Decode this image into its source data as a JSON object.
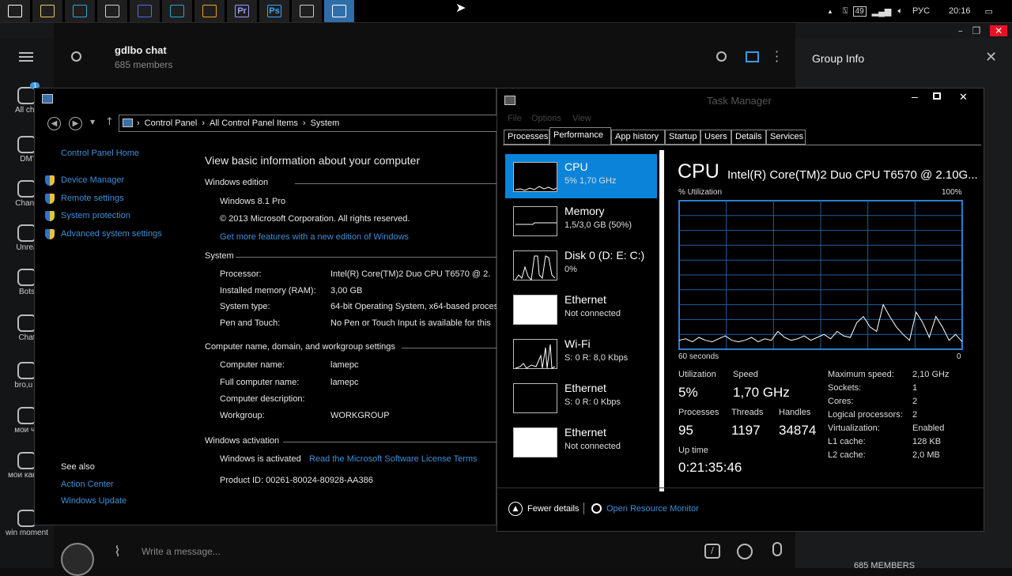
{
  "taskbar": {
    "apps": [
      {
        "icon": "windows-start-icon",
        "color": "#ffffff"
      },
      {
        "icon": "file-explorer-icon",
        "color": "#e8c860"
      },
      {
        "icon": "edge-icon",
        "color": "#36a2e0"
      },
      {
        "icon": "steam-icon",
        "color": "#c7d5e0"
      },
      {
        "icon": "discord-icon",
        "color": "#5865f2"
      },
      {
        "icon": "telegram-icon",
        "color": "#2aa3e0"
      },
      {
        "icon": "app-icon",
        "color": "#f0a020"
      },
      {
        "icon": "premiere-icon",
        "color": "#9999ff",
        "text": "Pr"
      },
      {
        "icon": "photoshop-icon",
        "color": "#31a8ff",
        "text": "Ps"
      },
      {
        "icon": "system-window-icon",
        "color": "#cccccc"
      },
      {
        "icon": "task-manager-icon",
        "color": "#ffffff"
      }
    ],
    "tray": {
      "battery": "49",
      "lang": "РУС",
      "time": "20:16"
    }
  },
  "telegram": {
    "header": {
      "title": "gdlbo chat",
      "subtitle": "685 members"
    },
    "right_panel": {
      "title": "Group Info",
      "members_label": "685 MEMBERS"
    },
    "input_placeholder": "Write a message...",
    "folders": [
      {
        "label": "All cha",
        "badge": "1"
      },
      {
        "label": "DM'"
      },
      {
        "label": "Chann"
      },
      {
        "label": "Unrea"
      },
      {
        "label": "Bots"
      },
      {
        "label": "Chat"
      },
      {
        "label": "bro,u p"
      },
      {
        "label": "мои ча"
      },
      {
        "label": "мои канал"
      },
      {
        "label": "win moment"
      }
    ]
  },
  "control_panel": {
    "breadcrumb": [
      "Control Panel",
      "All Control Panel Items",
      "System"
    ],
    "left_nav": {
      "home": "Control Panel Home",
      "links": [
        "Device Manager",
        "Remote settings",
        "System protection",
        "Advanced system settings"
      ],
      "see_also": "See also",
      "see_also_links": [
        "Action Center",
        "Windows Update"
      ]
    },
    "heading": "View basic information about your computer",
    "edition": {
      "section": "Windows edition",
      "name": "Windows 8.1 Pro",
      "copyright": "© 2013 Microsoft Corporation. All rights reserved.",
      "more_link": "Get more features with a new edition of Windows"
    },
    "system": {
      "section": "System",
      "rows": [
        {
          "label": "Processor:",
          "value": "Intel(R) Core(TM)2 Duo CPU     T6570  @ 2."
        },
        {
          "label": "Installed memory (RAM):",
          "value": "3,00 GB"
        },
        {
          "label": "System type:",
          "value": "64-bit Operating System, x64-based proces"
        },
        {
          "label": "Pen and Touch:",
          "value": "No Pen or Touch Input is available for this"
        }
      ]
    },
    "computer": {
      "section": "Computer name, domain, and workgroup settings",
      "rows": [
        {
          "label": "Computer name:",
          "value": "lamepc"
        },
        {
          "label": "Full computer name:",
          "value": "lamepc"
        },
        {
          "label": "Computer description:",
          "value": ""
        },
        {
          "label": "Workgroup:",
          "value": "WORKGROUP"
        }
      ]
    },
    "activation": {
      "section": "Windows activation",
      "status": "Windows is activated",
      "license_link": "Read the Microsoft Software License Terms",
      "product_id": "Product ID:  00261-80024-80928-AA386"
    }
  },
  "task_manager": {
    "title": "Task Manager",
    "menu": [
      "File",
      "Options",
      "View"
    ],
    "tabs": [
      "Processes",
      "Performance",
      "App history",
      "Startup",
      "Users",
      "Details",
      "Services"
    ],
    "selected_tab": "Performance",
    "sidebar": [
      {
        "name": "CPU",
        "sub": "5%  1,70 GHz",
        "selected": true
      },
      {
        "name": "Memory",
        "sub": "1,5/3,0 GB (50%)"
      },
      {
        "name": "Disk 0 (D: E: C:)",
        "sub": "0%"
      },
      {
        "name": "Ethernet",
        "sub": "Not connected"
      },
      {
        "name": "Wi-Fi",
        "sub": "S: 0 R: 8,0 Kbps"
      },
      {
        "name": "Ethernet",
        "sub": "S: 0 R: 0 Kbps"
      },
      {
        "name": "Ethernet",
        "sub": "Not connected"
      }
    ],
    "cpu": {
      "title": "CPU",
      "model": "Intel(R) Core(TM)2 Duo CPU T6570 @ 2.10G...",
      "util_label": "% Utilization",
      "max_label": "100%",
      "time_label": "60 seconds",
      "zero_label": "0",
      "utilization_label": "Utilization",
      "utilization": "5%",
      "speed_label": "Speed",
      "speed": "1,70 GHz",
      "processes_label": "Processes",
      "processes": "95",
      "threads_label": "Threads",
      "threads": "1197",
      "handles_label": "Handles",
      "handles": "34874",
      "uptime_label": "Up time",
      "uptime": "0:21:35:46",
      "details": [
        {
          "k": "Maximum speed:",
          "v": "2,10 GHz"
        },
        {
          "k": "Sockets:",
          "v": "1"
        },
        {
          "k": "Cores:",
          "v": "2"
        },
        {
          "k": "Logical processors:",
          "v": "2"
        },
        {
          "k": "Virtualization:",
          "v": "Enabled"
        },
        {
          "k": "L1 cache:",
          "v": "128 KB"
        },
        {
          "k": "L2 cache:",
          "v": "2,0 MB"
        }
      ],
      "history": [
        6,
        7,
        5,
        8,
        6,
        5,
        7,
        9,
        6,
        5,
        6,
        8,
        5,
        7,
        6,
        12,
        8,
        6,
        7,
        9,
        6,
        8,
        10,
        7,
        12,
        9,
        8,
        18,
        22,
        15,
        12,
        30,
        22,
        15,
        10,
        6,
        25,
        18,
        8,
        22,
        15,
        6,
        10,
        5
      ]
    },
    "footer": {
      "fewer": "Fewer details",
      "resmon": "Open Resource Monitor"
    }
  }
}
